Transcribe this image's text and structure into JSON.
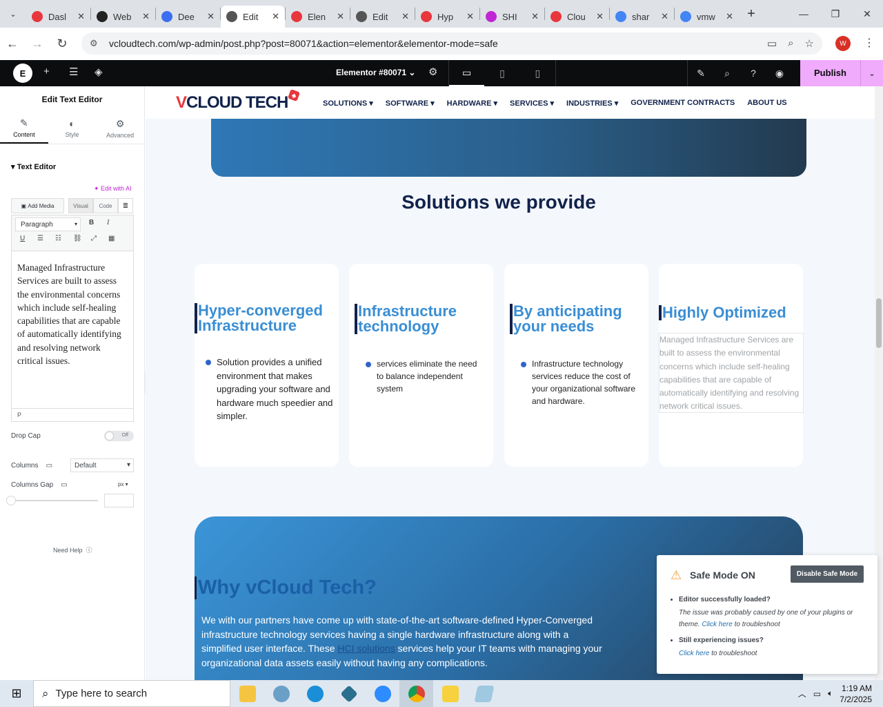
{
  "browser": {
    "tabs": [
      {
        "title": "Dasl",
        "color": "#e8363d"
      },
      {
        "title": "Web",
        "color": "#222"
      },
      {
        "title": "Dee",
        "color": "#3b6ef0"
      },
      {
        "title": "Edit",
        "color": "#555",
        "active": true
      },
      {
        "title": "Elen",
        "color": "#e8363d"
      },
      {
        "title": "Edit",
        "color": "#555"
      },
      {
        "title": "Hyp",
        "color": "#e8363d"
      },
      {
        "title": "SHI",
        "color": "#c026d3"
      },
      {
        "title": "Clou",
        "color": "#e8363d"
      },
      {
        "title": "shar",
        "color": "#4285f4"
      },
      {
        "title": "vmw",
        "color": "#4285f4"
      }
    ],
    "url": "vcloudtech.com/wp-admin/post.php?post=80071&action=elementor&elementor-mode=safe",
    "profile_initial": "W"
  },
  "elementor": {
    "doc_title": "Elementor #80071",
    "publish_label": "Publish"
  },
  "panel": {
    "title": "Edit Text Editor",
    "tabs": [
      "Content",
      "Style",
      "Advanced"
    ],
    "section": "Text Editor",
    "edit_ai": "Edit with AI",
    "add_media": "Add Media",
    "visual": "Visual",
    "code": "Code",
    "paragraph": "Paragraph",
    "editor_text": "Managed Infrastructure Services are built to assess the environmental concerns which include self-healing capabilities that are capable of automatically identifying and resolving network critical issues.",
    "path": "P",
    "drop_cap": "Drop Cap",
    "toggle_off": "Off",
    "columns": "Columns",
    "columns_value": "Default",
    "columns_gap": "Columns Gap",
    "unit": "px",
    "need_help": "Need Help"
  },
  "site": {
    "logo_v": "V",
    "logo_rest": "CLOUD TECH",
    "nav": [
      "SOLUTIONS ▾",
      "SOFTWARE ▾",
      "HARDWARE ▾",
      "SERVICES ▾",
      "INDUSTRIES ▾",
      "GOVERNMENT CONTRACTS",
      "ABOUT US"
    ],
    "solutions_title": "Solutions we provide",
    "cards": [
      {
        "title": "Hyper-converged Infrastructure",
        "text": "Solution provides a unified environment that makes upgrading your software and hardware much speedier and simpler."
      },
      {
        "title": "Infrastructure technology",
        "text": "services eliminate the need to balance independent system"
      },
      {
        "title": "By anticipating your needs",
        "text": "Infrastructure technology services reduce the cost of your organizational software and hardware."
      },
      {
        "title": "Highly Optimized",
        "text": "Managed Infrastructure Services are built to assess the environmental concerns which include self-healing capabilities that are capable of automatically identifying and resolving network critical issues."
      }
    ],
    "why_title": "Why vCloud Tech?",
    "why_text_1": "We with our partners have come up with state-of-the-art software-defined Hyper-Converged infrastructure technology services having a single hardware infrastructure along with a simplified user interface. These ",
    "why_link": "HCI solutions",
    "why_text_2": " services help your IT teams with managing your organizational data assets easily without having any complications."
  },
  "safe_mode": {
    "title": "Safe Mode ON",
    "disable_label": "Disable Safe Mode",
    "item1_title": "Editor successfully loaded?",
    "item1_text": "The issue was probably caused by one of your plugins or theme.",
    "item1_link": "Click here",
    "item1_tail": " to troubleshoot",
    "item2_title": "Still experiencing issues?",
    "item2_link": "Click here",
    "item2_tail": " to troubleshoot"
  },
  "taskbar": {
    "search_placeholder": "Type here to search",
    "time": "1:19 AM",
    "date": "7/2/2025"
  }
}
